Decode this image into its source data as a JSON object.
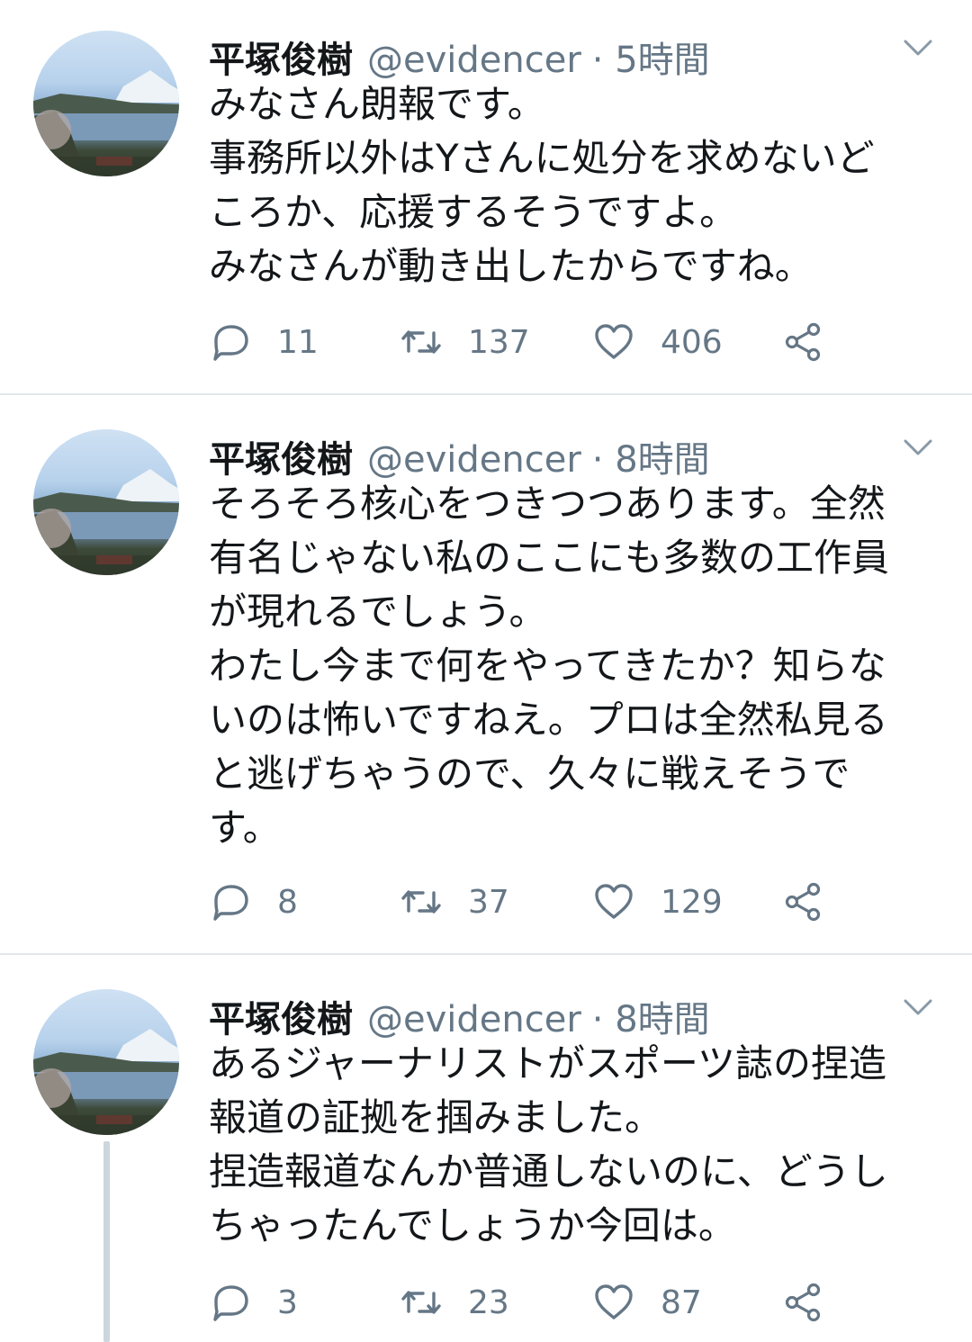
{
  "tweets": [
    {
      "name": "平塚俊樹",
      "handle": "@evidencer",
      "time": "· 5時間",
      "lines": [
        "みなさん朗報です。",
        "事務所以外はYさんに処分を求めないど",
        "ころか、応援するそうですよ。",
        "みなさんが動き出したからですね。"
      ],
      "replies": "11",
      "retweets": "137",
      "likes": "406"
    },
    {
      "name": "平塚俊樹",
      "handle": "@evidencer",
      "time": "· 8時間",
      "lines": [
        "そろそろ核心をつきつつあります。全然",
        "有名じゃない私のここにも多数の工作員",
        "が現れるでしょう。",
        "わたし今まで何をやってきたか？知らな",
        "いのは怖いですねえ。プロは全然私見る",
        "と逃げちゃうので、久々に戦えそうで",
        "す。"
      ],
      "replies": "8",
      "retweets": "37",
      "likes": "129"
    },
    {
      "name": "平塚俊樹",
      "handle": "@evidencer",
      "time": "· 8時間",
      "lines": [
        "あるジャーナリストがスポーツ誌の捏造",
        "報道の証拠を掴みました。",
        "捏造報道なんか普通しないのに、どうし",
        "ちゃったんでしょうか今回は。"
      ],
      "replies": "3",
      "retweets": "23",
      "likes": "87"
    }
  ],
  "icons": {
    "reply": "reply-icon",
    "retweet": "retweet-icon",
    "like": "like-icon",
    "share": "share-icon",
    "menu": "chevron-down-icon"
  },
  "colors": {
    "text": "#14171a",
    "muted": "#657786",
    "divider": "#e1e8ed"
  }
}
